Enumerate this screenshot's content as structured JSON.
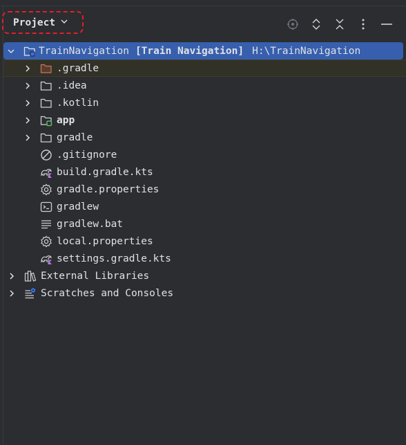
{
  "header": {
    "project_label": "Project",
    "tools": [
      "locate-icon",
      "expand-all-icon",
      "collapse-all-icon",
      "more-options-icon",
      "hide-icon"
    ]
  },
  "tree": {
    "root": {
      "name": "TrainNavigation",
      "module": "[Train Navigation]",
      "path": "H:\\TrainNavigation"
    },
    "items": [
      {
        "label": ".gradle",
        "icon": "folder-excluded-icon"
      },
      {
        "label": ".idea",
        "icon": "folder-icon"
      },
      {
        "label": ".kotlin",
        "icon": "folder-icon"
      },
      {
        "label": "app",
        "icon": "module-folder-icon"
      },
      {
        "label": "gradle",
        "icon": "folder-icon"
      },
      {
        "label": ".gitignore",
        "icon": "ignore-file-icon"
      },
      {
        "label": "build.gradle.kts",
        "icon": "gradle-kts-icon"
      },
      {
        "label": "gradle.properties",
        "icon": "properties-icon"
      },
      {
        "label": "gradlew",
        "icon": "terminal-script-icon"
      },
      {
        "label": "gradlew.bat",
        "icon": "text-file-icon"
      },
      {
        "label": "local.properties",
        "icon": "properties-icon"
      },
      {
        "label": "settings.gradle.kts",
        "icon": "gradle-kts-icon"
      }
    ],
    "external_libraries": "External Libraries",
    "scratches": "Scratches and Consoles"
  }
}
